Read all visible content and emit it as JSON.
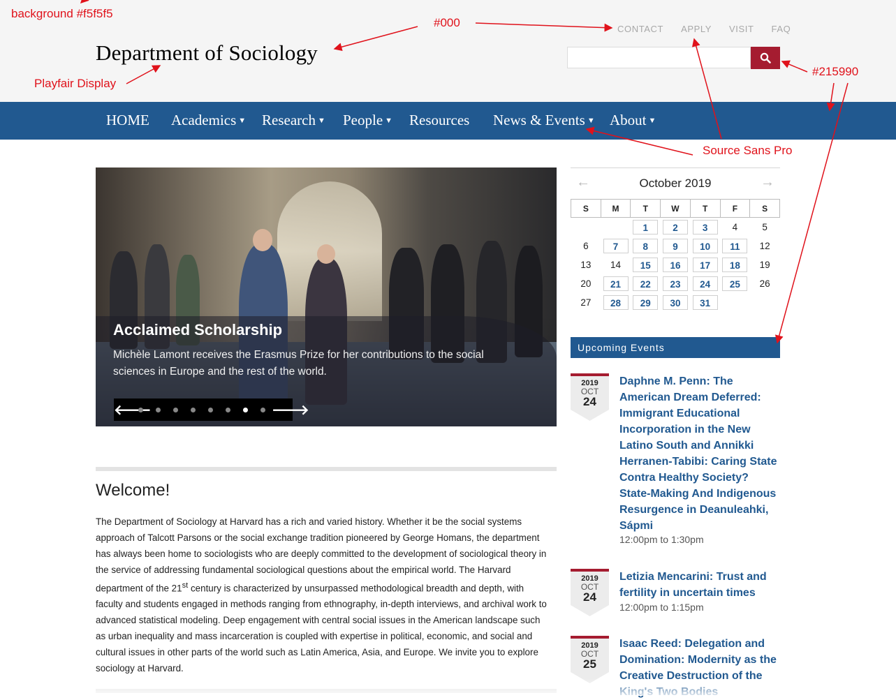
{
  "annotations": {
    "background": "background #f5f5f5",
    "black": "#000",
    "font_serif": "Playfair Display",
    "nav_color": "#215990",
    "font_sans": "Source Sans Pro"
  },
  "colors": {
    "header_bg": "#f5f5f5",
    "title": "#000",
    "nav_bg": "#215990",
    "accent_red": "#a51c30"
  },
  "header": {
    "site_title": "Department of Sociology",
    "util_links": [
      "CONTACT",
      "APPLY",
      "VISIT",
      "FAQ"
    ],
    "search": {
      "placeholder": "",
      "button_icon": "search-icon"
    }
  },
  "nav": {
    "items": [
      "HOME",
      "Academics",
      "Research",
      "People",
      "Resources",
      "News & Events",
      "About"
    ]
  },
  "slider": {
    "title": "Acclaimed Scholarship",
    "text": "Michèle Lamont receives the Erasmus Prize for her contributions to the social sciences in Europe and the rest of the world.",
    "dot_count": 8,
    "active_dot": 7
  },
  "welcome": {
    "title": "Welcome!",
    "text_before": "The Department of Sociology at Harvard has a rich and varied history. Whether it be the social systems approach of Talcott Parsons or the social exchange tradition pioneered by George Homans, the department has always been home to sociologists who are deeply committed to the development of sociological theory in the service of addressing fundamental sociological questions about the empirical world. The Harvard department of the 21",
    "sup": "st",
    "text_after": " century is characterized by unsurpassed methodological breadth and depth, with faculty and students engaged in methods ranging from ethnography, in-depth interviews, and archival work to advanced statistical modeling. Deep engagement with central social issues in the American landscape such as urban inequality and mass incarceration is coupled with expertise in political, economic, and social and cultural issues in other parts of the world such as Latin America, Asia, and Europe. We invite you to explore sociology at Harvard."
  },
  "calendar": {
    "month": "October 2019",
    "prev_arrow": "←",
    "next_arrow": "→",
    "days": [
      "S",
      "M",
      "T",
      "W",
      "T",
      "F",
      "S"
    ],
    "weeks": [
      [
        "",
        "",
        "1",
        "2",
        "3",
        "4",
        "5"
      ],
      [
        "6",
        "7",
        "8",
        "9",
        "10",
        "11",
        "12"
      ],
      [
        "13",
        "14",
        "15",
        "16",
        "17",
        "18",
        "19"
      ],
      [
        "20",
        "21",
        "22",
        "23",
        "24",
        "25",
        "26"
      ],
      [
        "27",
        "28",
        "29",
        "30",
        "31",
        "",
        ""
      ]
    ],
    "event_days": [
      "1",
      "2",
      "3",
      "7",
      "8",
      "9",
      "10",
      "11",
      "15",
      "16",
      "17",
      "18",
      "21",
      "22",
      "23",
      "24",
      "25",
      "28",
      "29",
      "30",
      "31"
    ]
  },
  "events": {
    "heading": "Upcoming Events",
    "items": [
      {
        "year": "2019",
        "month": "OCT",
        "day": "24",
        "title": "Daphne M. Penn: The American Dream Deferred: Immigrant Educational Incorporation in the New Latino South and Annikki Herranen-Tabibi: Caring State Contra Healthy Society? State-Making And Indigenous Resurgence in Deanuleahki, Sápmi",
        "time": "12:00pm to 1:30pm"
      },
      {
        "year": "2019",
        "month": "OCT",
        "day": "24",
        "title": "Letizia Mencarini: Trust and fertility in uncertain times",
        "time": "12:00pm to 1:15pm"
      },
      {
        "year": "2019",
        "month": "OCT",
        "day": "25",
        "title": "Isaac Reed: Delegation and Domination: Modernity as the Creative Destruction of the King's Two Bodies",
        "time": ""
      }
    ]
  }
}
